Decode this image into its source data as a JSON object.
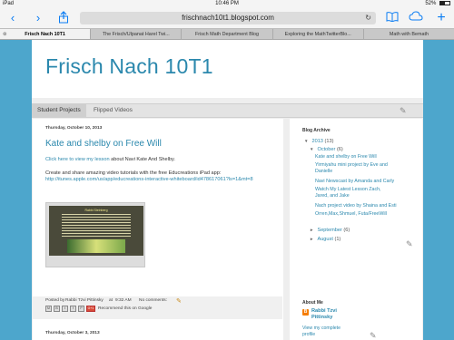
{
  "status_bar": {
    "device": "iPad",
    "time": "10:46 PM",
    "battery": "52%",
    "battery_level": 0.52
  },
  "browser": {
    "url": "frischnach10t1.blogspot.com",
    "icons": {
      "back": "chevron-left-icon",
      "forward": "chevron-right-icon",
      "share": "share-icon",
      "reload": "reload-icon",
      "bookmarks": "book-icon",
      "cloud": "cloud-icon",
      "new_tab": "plus-icon"
    },
    "tabs": [
      {
        "label": "Frisch Nach 10T1"
      },
      {
        "label": "The Frisch/Ulpanat Harel Twi..."
      },
      {
        "label": "Frisch Math Department Blog"
      },
      {
        "label": "Exploring the MathTwitterBlo..."
      },
      {
        "label": "Math with Bemath"
      }
    ]
  },
  "blog": {
    "title": "Frisch Nach 10T1",
    "nav": [
      "Student Projects",
      "Flipped Videos"
    ],
    "post": {
      "date": "Thursday, October 10, 2013",
      "title": "Kate and shelby on Free Will",
      "line1_link": "Click here to view my lesson",
      "line1_rest": " about Navi Kate And Shelby.",
      "line2": "Create and share amazing video tutorials with the free Educreations iPad app:",
      "line3_link": "http://itunes.apple.com/us/app/educreations-interactive-whiteboard/id478617061?ls=1&mt=8",
      "thumb_title": "Rabbi Steinberg",
      "footer_posted": "Posted by",
      "footer_author": "Rabbi Tzvi Pittinsky",
      "footer_at": "at",
      "footer_time": "9:32 AM",
      "footer_comments": "No comments:",
      "share_labels": [
        "M",
        "B",
        "t",
        "f",
        "P",
        "G+1"
      ],
      "share_google": "Recommend this on Google"
    },
    "next_post_date": "Thursday, October 3, 2013",
    "sidebar": {
      "archive_heading": "Blog Archive",
      "year": "2013",
      "year_count": "(13)",
      "month": "October",
      "month_count": "(6)",
      "posts": [
        "Kate and shelby on Free Will",
        "Yirmiyahu mini project by Eve and Danielle",
        "Navi Newscast by Amanda and Carly",
        "Watch My Latest Lesson Zach, Jared, and Jake",
        "Nach project video by Shaina and Esti",
        "Orren,Max,Shmuel, Futa/FreeWill"
      ],
      "other_months": [
        {
          "name": "September",
          "count": "(6)"
        },
        {
          "name": "August",
          "count": "(1)"
        }
      ],
      "about_heading": "About Me",
      "author_line1": "Rabbi Tzvi",
      "author_line2": "Pittinsky",
      "profile_line1": "View my complete",
      "profile_line2": "profile"
    }
  }
}
